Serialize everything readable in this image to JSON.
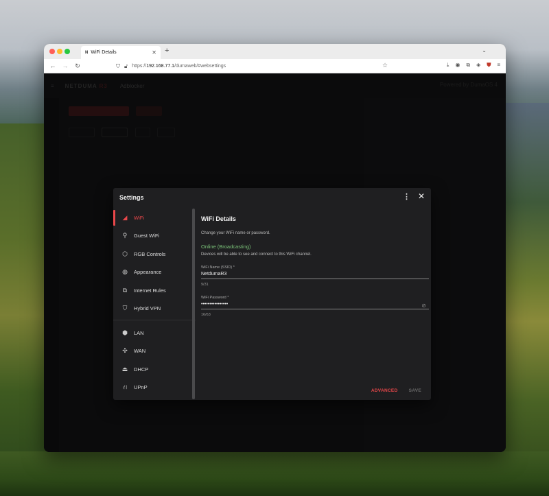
{
  "browser": {
    "tab_title": "WiFi Details",
    "tab_favicon": "N",
    "url_host": "192.168.77.1",
    "url_path": "/dumaweb/#websettings",
    "url_prefix": "https://"
  },
  "app": {
    "logo_text": "NETDUMA",
    "logo_model": "R3",
    "sub_title": "Adblocker",
    "powered_text": "Powered by DumaOS 4"
  },
  "dialog": {
    "title": "Settings",
    "menu": [
      {
        "label": "WiFi",
        "icon": "wifi-icon"
      },
      {
        "label": "Guest WiFi",
        "icon": "guest-wifi-icon"
      },
      {
        "label": "RGB Controls",
        "icon": "rgb-icon"
      },
      {
        "label": "Appearance",
        "icon": "palette-icon"
      },
      {
        "label": "Internet Rules",
        "icon": "internet-rules-icon"
      },
      {
        "label": "Hybrid VPN",
        "icon": "shield-icon"
      },
      {
        "label": "LAN",
        "icon": "lan-icon"
      },
      {
        "label": "WAN",
        "icon": "wan-icon"
      },
      {
        "label": "DHCP",
        "icon": "dhcp-icon"
      },
      {
        "label": "UPnP",
        "icon": "upnp-icon"
      }
    ],
    "active_index": 0
  },
  "content": {
    "title": "WiFi Details",
    "description": "Change your WiFi name or password.",
    "status": "Online (Broadcasting)",
    "status_description": "Devices will be able to see and connect to this WiFi channel.",
    "ssid_label": "WiFi Name (SSID) *",
    "ssid_value": "NetdumaR3",
    "ssid_count": "9/31",
    "password_label": "WiFi Password *",
    "password_value": "••••••••••••••••",
    "password_count": "16/63",
    "advanced_label": "ADVANCED",
    "save_label": "SAVE"
  },
  "colors": {
    "accent": "#e9474a",
    "status_ok": "#7cc57a",
    "dialog_bg": "#1f1f21"
  }
}
